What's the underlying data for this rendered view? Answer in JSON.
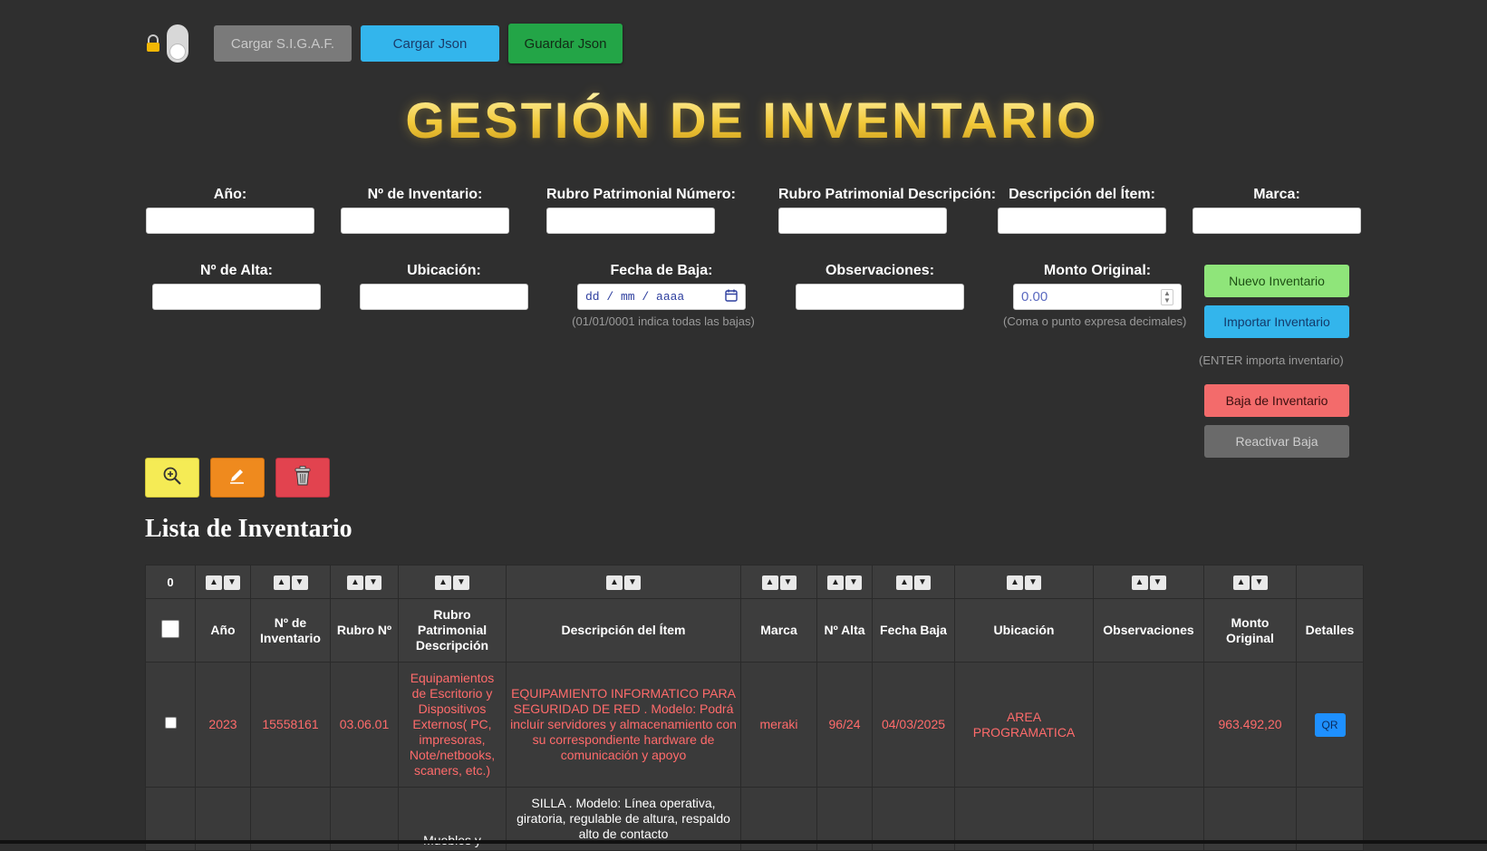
{
  "toolbar": {
    "cargar_sigaf": "Cargar S.I.G.A.F.",
    "cargar_json": "Cargar Json",
    "guardar_json": "Guardar Json"
  },
  "title": "GESTIÓN DE INVENTARIO",
  "form": {
    "anio": {
      "label": "Año:",
      "value": ""
    },
    "nro_inventario": {
      "label": "Nº de Inventario:",
      "value": ""
    },
    "rubro_numero": {
      "label": "Rubro Patrimonial Número:",
      "value": ""
    },
    "rubro_descripcion": {
      "label": "Rubro Patrimonial Descripción:",
      "value": ""
    },
    "descripcion_item": {
      "label": "Descripción del Ítem:",
      "value": ""
    },
    "marca": {
      "label": "Marca:",
      "value": ""
    },
    "nro_alta": {
      "label": "Nº de Alta:",
      "value": ""
    },
    "ubicacion": {
      "label": "Ubicación:",
      "value": ""
    },
    "fecha_baja": {
      "label": "Fecha de Baja:",
      "placeholder": "dd / mm / aaaa",
      "hint": "(01/01/0001 indica todas las bajas)"
    },
    "observaciones": {
      "label": "Observaciones:",
      "value": ""
    },
    "monto_original": {
      "label": "Monto Original:",
      "value": "0.00",
      "hint": "(Coma o punto expresa decimales)"
    }
  },
  "side_buttons": {
    "nuevo": "Nuevo Inventario",
    "importar": "Importar Inventario",
    "enter_hint": "(ENTER importa inventario)",
    "baja": "Baja de Inventario",
    "reactivar": "Reactivar Baja"
  },
  "action_icons": [
    "zoom-in-icon",
    "pencil-icon",
    "trash-icon"
  ],
  "list_title": "Lista de Inventario",
  "table": {
    "selected_count": "0",
    "headers": [
      "Año",
      "Nº de Inventario",
      "Rubro Nº",
      "Rubro Patrimonial Descripción",
      "Descripción del Ítem",
      "Marca",
      "Nº Alta",
      "Fecha Baja",
      "Ubicación",
      "Observaciones",
      "Monto Original",
      "Detalles"
    ],
    "rows": [
      {
        "anio": "2023",
        "nro_inventario": "15558161",
        "rubro": "03.06.01",
        "rubro_desc": "Equipamientos de Escritorio y Dispositivos Externos( PC, impresoras, Note/netbooks, scaners, etc.)",
        "descripcion": "EQUIPAMIENTO INFORMATICO PARA SEGURIDAD DE RED . Modelo: Podrá incluír servidores y almacenamiento con su correspondiente hardware de comunicación y apoyo",
        "marca": "meraki",
        "alta": "96/24",
        "fecha_baja": "04/03/2025",
        "ubicacion": "AREA PROGRAMATICA",
        "observaciones": "",
        "monto": "963.492,20",
        "detalle": "QR"
      },
      {
        "anio": "",
        "nro_inventario": "",
        "rubro": "",
        "rubro_desc": "Muebles y",
        "descripcion": "SILLA . Modelo: Línea operativa, giratoria, regulable de altura, respaldo alto de contacto",
        "marca": "",
        "alta": "",
        "fecha_baja": "",
        "ubicacion": "",
        "observaciones": "",
        "monto": "",
        "detalle": ""
      }
    ]
  },
  "colors": {
    "background": "#2f2f2f",
    "title_gold": "#f2c93a",
    "baja_row_text": "#ff6b6b",
    "blue_button": "#33b5ec",
    "green_button": "#23a547"
  }
}
